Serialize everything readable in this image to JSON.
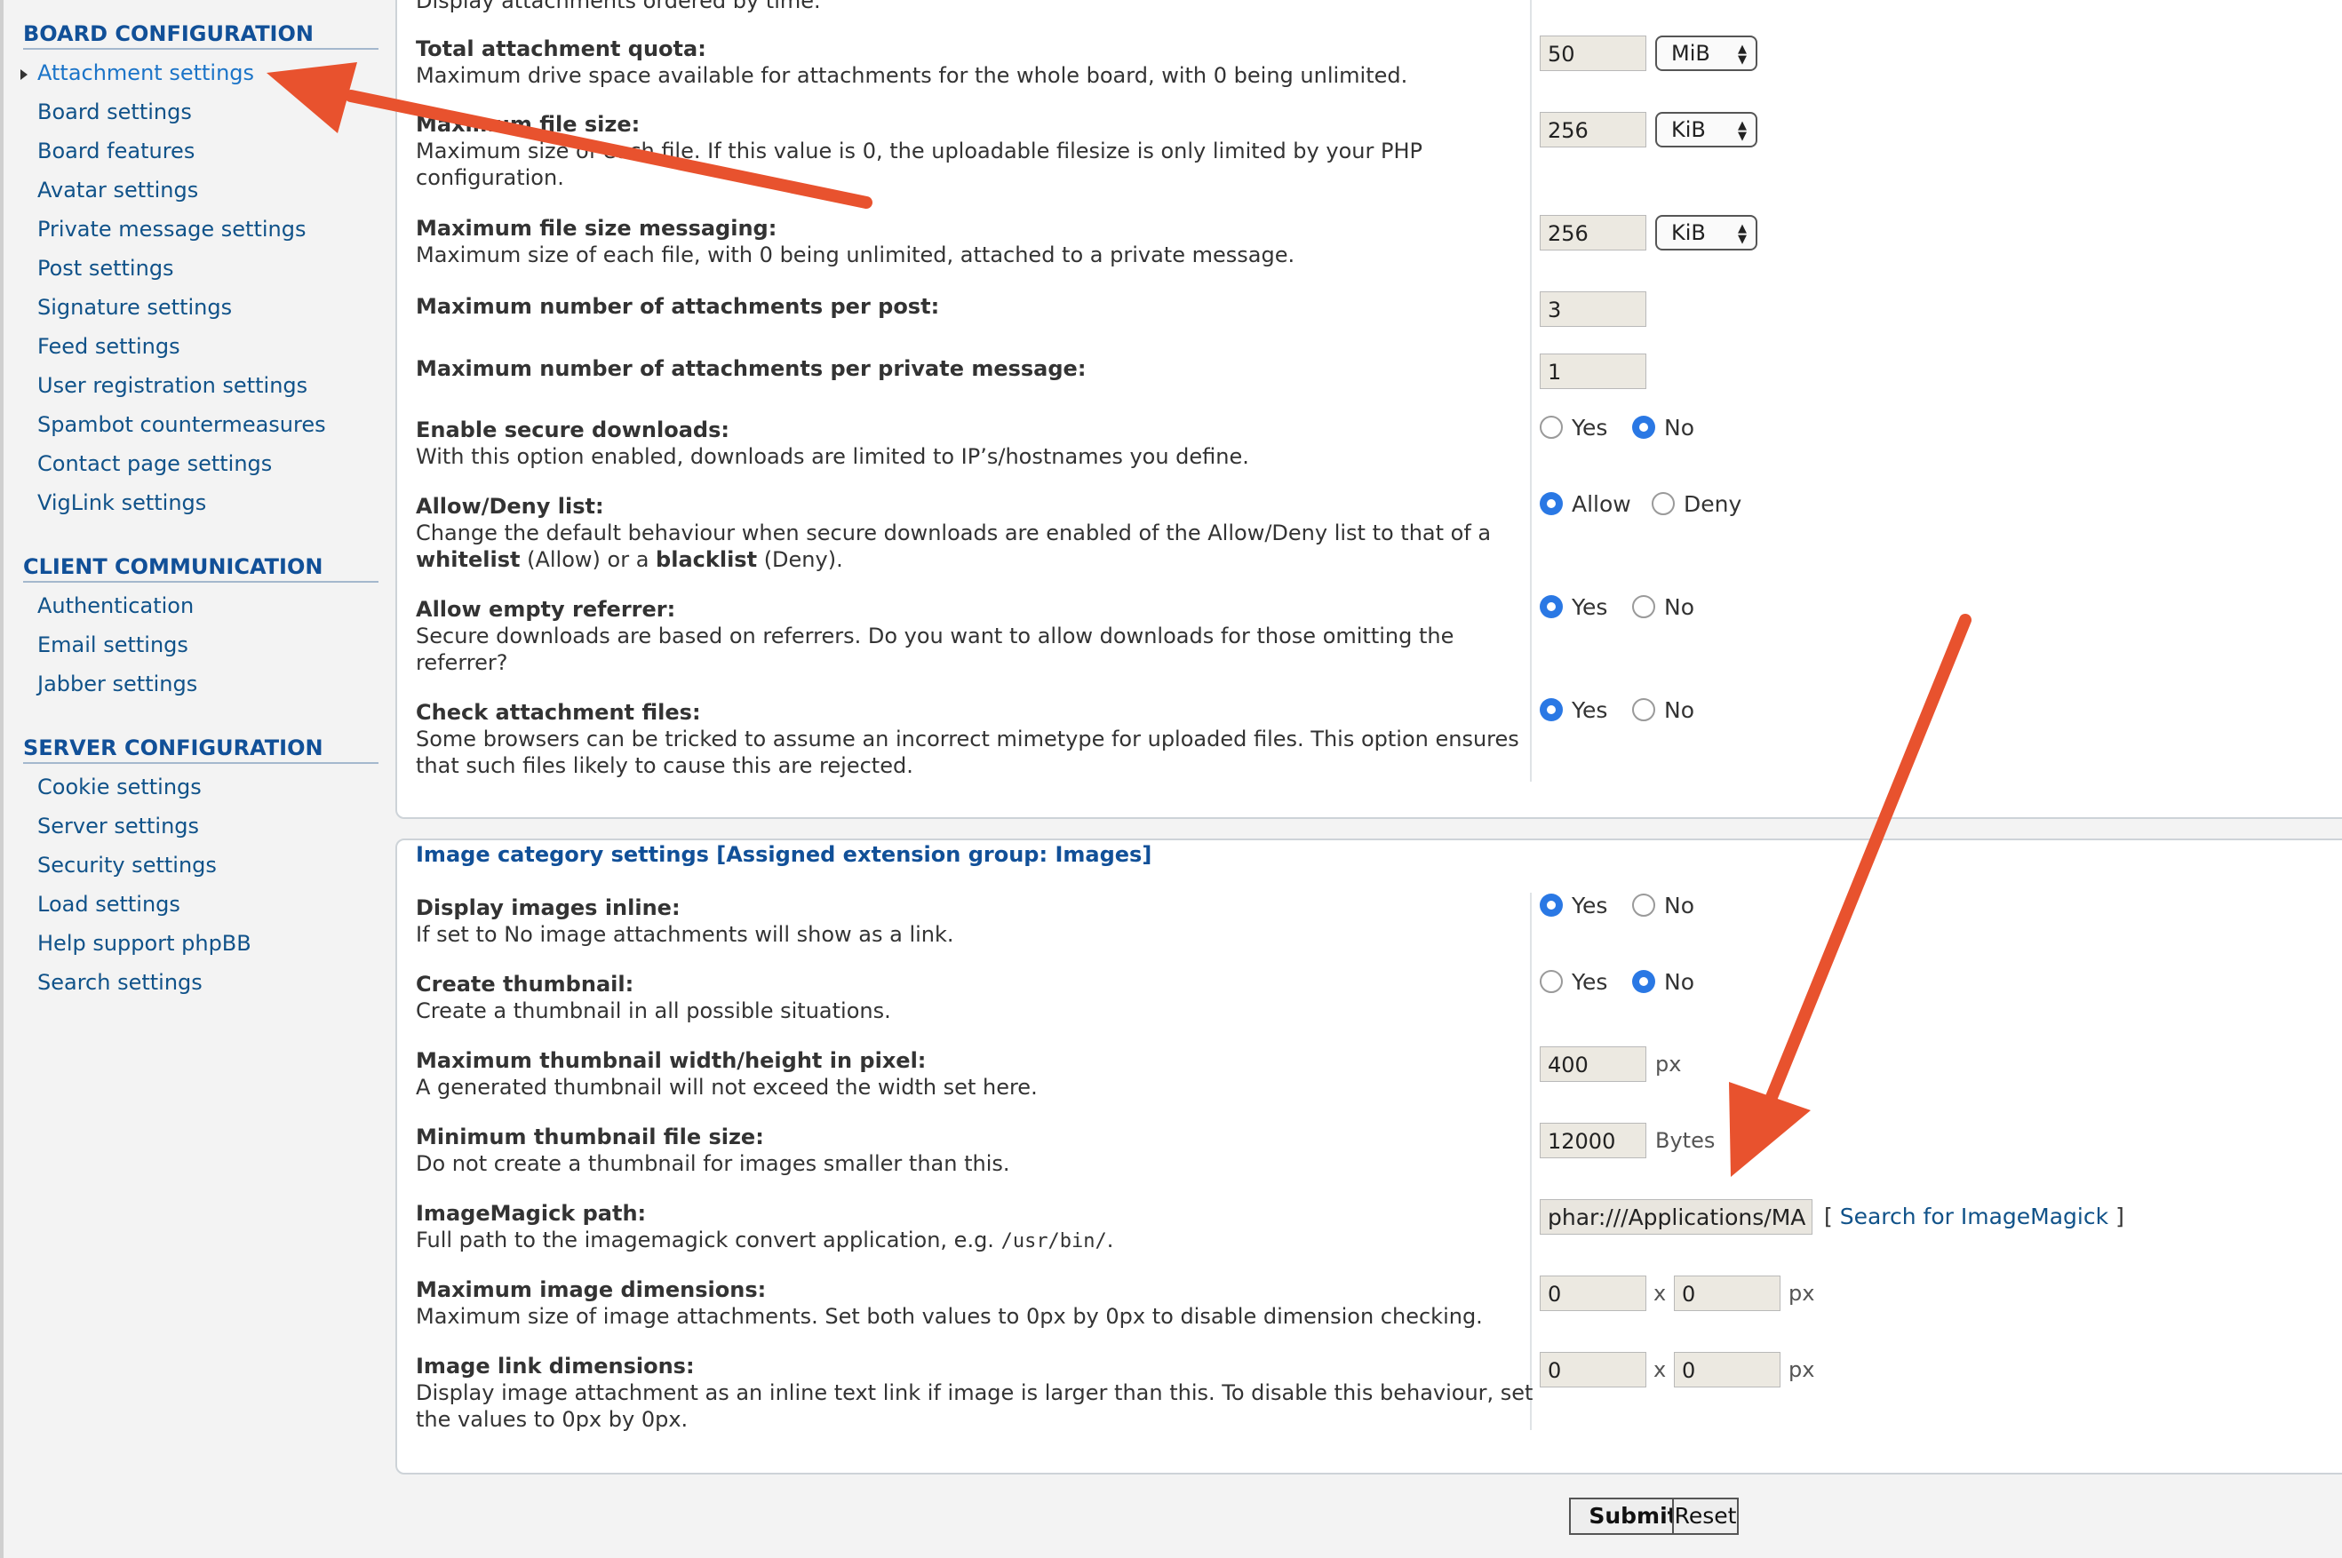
{
  "top_cut_text": "Display attachments ordered by time.",
  "sidebar": {
    "sections": [
      {
        "title": "BOARD CONFIGURATION",
        "items": [
          "Attachment settings",
          "Board settings",
          "Board features",
          "Avatar settings",
          "Private message settings",
          "Post settings",
          "Signature settings",
          "Feed settings",
          "User registration settings",
          "Spambot countermeasures",
          "Contact page settings",
          "VigLink settings"
        ]
      },
      {
        "title": "CLIENT COMMUNICATION",
        "items": [
          "Authentication",
          "Email settings",
          "Jabber settings"
        ]
      },
      {
        "title": "SERVER CONFIGURATION",
        "items": [
          "Cookie settings",
          "Server settings",
          "Security settings",
          "Load settings",
          "Help support phpBB",
          "Search settings"
        ]
      }
    ],
    "active_item": "Attachment settings"
  },
  "settings": {
    "quota": {
      "label": "Total attachment quota:",
      "desc": "Maximum drive space available for attachments for the whole board, with 0 being unlimited.",
      "value": "50",
      "unit": "MiB"
    },
    "max_filesize": {
      "label": "Maximum file size:",
      "desc": "Maximum size of each file. If this value is 0, the uploadable filesize is only limited by your PHP configuration.",
      "value": "256",
      "unit": "KiB"
    },
    "max_filesize_pm": {
      "label": "Maximum file size messaging:",
      "desc": "Maximum size of each file, with 0 being unlimited, attached to a private message.",
      "value": "256",
      "unit": "KiB"
    },
    "max_attachments": {
      "label": "Maximum number of attachments per post:",
      "value": "3"
    },
    "max_attachments_pm": {
      "label": "Maximum number of attachments per private message:",
      "value": "1"
    },
    "secure_downloads": {
      "label": "Enable secure downloads:",
      "desc": "With this option enabled, downloads are limited to IP’s/hostnames you define.",
      "options": [
        "Yes",
        "No"
      ],
      "selected": "No"
    },
    "allow_deny": {
      "label": "Allow/Deny list:",
      "desc_before": "Change the default behaviour when secure downloads are enabled of the Allow/Deny list to that of a",
      "desc_whitelist": "whitelist",
      "desc_mid": "(Allow) or a",
      "desc_blacklist": "blacklist",
      "desc_after": "(Deny).",
      "options": [
        "Allow",
        "Deny"
      ],
      "selected": "Allow"
    },
    "empty_referrer": {
      "label": "Allow empty referrer:",
      "desc": "Secure downloads are based on referrers. Do you want to allow downloads for those omitting the referrer?",
      "options": [
        "Yes",
        "No"
      ],
      "selected": "Yes"
    },
    "check_files": {
      "label": "Check attachment files:",
      "desc": "Some browsers can be tricked to assume an incorrect mimetype for uploaded files. This option ensures that such files likely to cause this are rejected.",
      "options": [
        "Yes",
        "No"
      ],
      "selected": "Yes"
    }
  },
  "image_category": {
    "title": "Image category settings [Assigned extension group: Images]",
    "inline": {
      "label": "Display images inline:",
      "desc": "If set to No image attachments will show as a link.",
      "options": [
        "Yes",
        "No"
      ],
      "selected": "Yes"
    },
    "thumbnail": {
      "label": "Create thumbnail:",
      "desc": "Create a thumbnail in all possible situations.",
      "options": [
        "Yes",
        "No"
      ],
      "selected": "No"
    },
    "thumb_max": {
      "label": "Maximum thumbnail width/height in pixel:",
      "desc": "A generated thumbnail will not exceed the width set here.",
      "value": "400",
      "unit": "px"
    },
    "thumb_min": {
      "label": "Minimum thumbnail file size:",
      "desc": "Do not create a thumbnail for images smaller than this.",
      "value": "12000",
      "unit": "Bytes"
    },
    "imagemagick": {
      "label": "ImageMagick path:",
      "desc_before": "Full path to the imagemagick convert application, e.g.",
      "desc_code": "/usr/bin/",
      "desc_after": ".",
      "value": "phar:///Applications/MA",
      "search_open": "[",
      "search_label": "Search for ImageMagick",
      "search_close": "]"
    },
    "max_dims": {
      "label": "Maximum image dimensions:",
      "desc": "Maximum size of image attachments. Set both values to 0px by 0px to disable dimension checking.",
      "w": "0",
      "h": "0",
      "sep": "x",
      "unit": "px"
    },
    "link_dims": {
      "label": "Image link dimensions:",
      "desc": "Display image attachment as an inline text link if image is larger than this. To disable this behaviour, set the values to 0px by 0px.",
      "w": "0",
      "h": "0",
      "sep": "x",
      "unit": "px"
    }
  },
  "buttons": {
    "submit": "Submit",
    "reset": "Reset"
  },
  "colors": {
    "annotation_arrow": "#e8522e",
    "link": "#105289",
    "radio_selected": "#2a78e4",
    "heading": "#115098"
  }
}
